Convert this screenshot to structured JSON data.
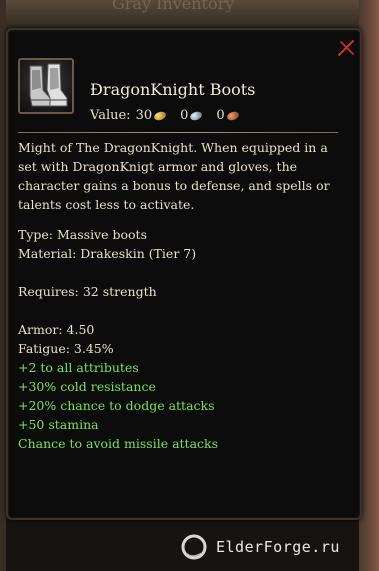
{
  "background": {
    "header_text": "Gray Inventory"
  },
  "tooltip": {
    "item_name": "ĐragonKnight Boots",
    "value_label": "Value:",
    "value_gold": "30",
    "value_silver": "0",
    "value_copper": "0",
    "description": [
      "Might of The DragonKnight. When equipped in a",
      "set with DragonKnigt armor and gloves, the",
      "character gains a bonus to defense, and spells or",
      "talents cost less to activate."
    ],
    "type": "Type: Massive boots",
    "material": "Material: Drakeskin (Tier 7)",
    "requires": "Requires: 32 strength",
    "armor": "Armor: 4.50",
    "fatigue": "Fatigue: 3.45%",
    "bonuses": [
      "+2 to all attributes",
      "+30% cold resistance",
      "+20% chance to dodge attacks",
      "+50 stamina",
      "Chance to avoid missile attacks"
    ]
  },
  "footer": {
    "site": "ElderForge.ru"
  },
  "colors": {
    "bonus_green": "#7ee05a",
    "close_red": "#d0322a",
    "panel_bg": "#0c0c0c"
  },
  "icons": [
    "close-icon",
    "boots-item-icon",
    "gold-coin-icon",
    "silver-coin-icon",
    "copper-coin-icon",
    "elderforge-logo-icon"
  ]
}
